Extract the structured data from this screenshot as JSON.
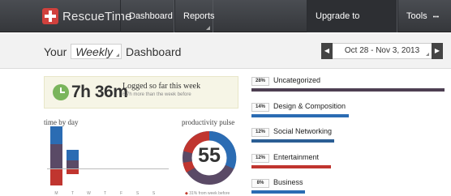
{
  "nav": {
    "logo_text": "RescueTime",
    "dashboard": "Dashboard",
    "reports": "Reports",
    "upgrade": "Upgrade to Premium",
    "upgrade_badge": "?",
    "tools": "Tools",
    "tools_dots": "•••"
  },
  "header": {
    "your": "Your",
    "period": "Weekly",
    "dashboard": "Dashboard",
    "date_range": "Oct 28 - Nov 3, 2013",
    "prev_arrow": "◀",
    "next_arrow": "▶"
  },
  "logged": {
    "time": "7h 36m",
    "caption": "Logged so far this week",
    "sub": "6.7h more than the week before"
  },
  "time_by_day": {
    "label": "time by day",
    "day_letters": [
      "M",
      "T",
      "W",
      "T",
      "F",
      "S",
      "S"
    ]
  },
  "pulse": {
    "label": "productivity pulse",
    "value": "55",
    "sub_dot": "◆",
    "sub": "31% from week before"
  },
  "categories": [
    {
      "pct": "28%",
      "name": "Uncategorized",
      "color": "#4d3f52",
      "share": 0.28
    },
    {
      "pct": "14%",
      "name": "Design & Composition",
      "color": "#2b6cb3",
      "share": 0.14
    },
    {
      "pct": "12%",
      "name": "Social Networking",
      "color": "#2b5e94",
      "share": 0.12
    },
    {
      "pct": "12%",
      "name": "Entertainment",
      "color": "#c0352f",
      "share": 0.12
    },
    {
      "pct": "8%",
      "name": "Business",
      "color": "#2b6cb3",
      "share": 0.08
    }
  ],
  "colors": {
    "productive_blue": "#2b6cb3",
    "neutral_purple": "#5a4a66",
    "distracting_red": "#c0352f",
    "accent_green": "#6eb22d"
  }
}
